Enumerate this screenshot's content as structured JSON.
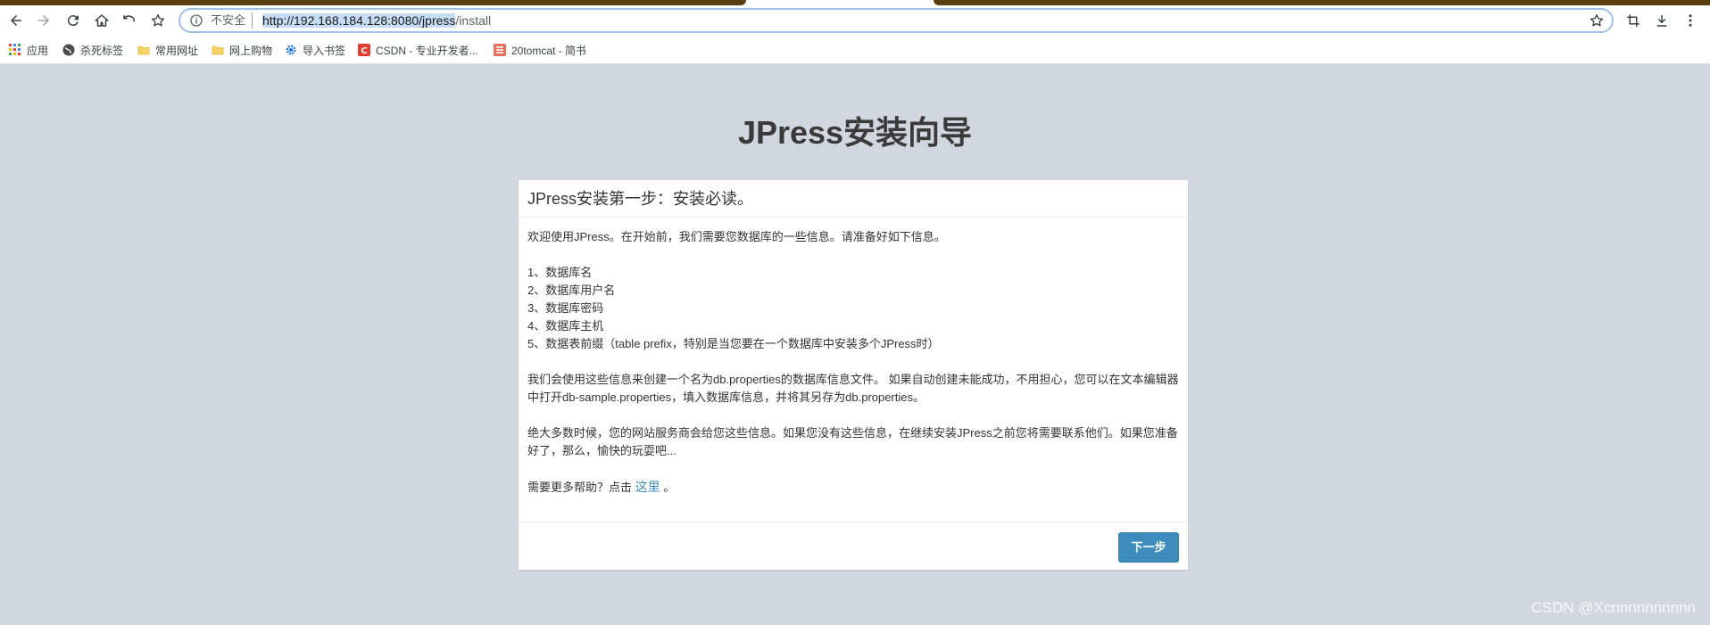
{
  "browser": {
    "security_label": "不安全",
    "url_selected": "http://192.168.184.128:8080/jpress",
    "url_rest": "/install",
    "bookmarks": [
      {
        "label": "应用",
        "icon": "apps-grid-icon"
      },
      {
        "label": "杀死标签",
        "icon": "globe-icon"
      },
      {
        "label": "常用网址",
        "icon": "folder-icon"
      },
      {
        "label": "网上购物",
        "icon": "folder-icon"
      },
      {
        "label": "导入书签",
        "icon": "gear-icon"
      },
      {
        "label": "CSDN - 专业开发者...",
        "icon": "csdn-icon"
      },
      {
        "label": "20tomcat - 简书",
        "icon": "jianshu-icon"
      }
    ]
  },
  "page": {
    "title": "JPress安装向导",
    "panel": {
      "heading": "JPress安装第一步：安装必读。",
      "intro": "欢迎使用JPress。在开始前，我们需要您数据库的一些信息。请准备好如下信息。",
      "items": [
        "1、数据库名",
        "2、数据库用户名",
        "3、数据库密码",
        "4、数据库主机",
        "5、数据表前缀（table prefix，特别是当您要在一个数据库中安装多个JPress时）"
      ],
      "para1": "我们会使用这些信息来创建一个名为db.properties的数据库信息文件。 如果自动创建未能成功，不用担心，您可以在文本编辑器中打开db-sample.properties，填入数据库信息，并将其另存为db.properties。",
      "para2": "绝大多数时候，您的网站服务商会给您这些信息。如果您没有这些信息，在继续安装JPress之前您将需要联系他们。如果您准备好了，那么，愉快的玩耍吧...",
      "help_prefix": "需要更多帮助？点击",
      "help_link": "这里",
      "help_suffix": "。",
      "next_label": "下一步"
    }
  },
  "watermark": "CSDN @Xcnnnnnnnnnn",
  "colors": {
    "page_bg": "#d2d6de",
    "primary": "#3c8dbc",
    "tab_strip": "#5b3d12"
  }
}
